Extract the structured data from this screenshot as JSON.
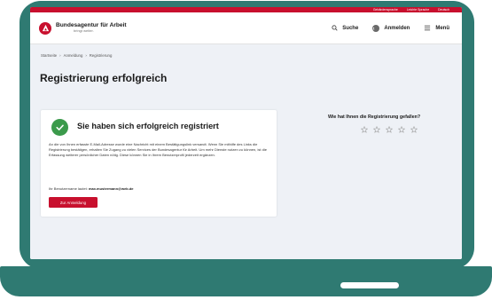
{
  "topbar": {
    "links": [
      "Gebärdensprache",
      "Leichte Sprache",
      "Deutsch"
    ]
  },
  "header": {
    "brand_name": "Bundesagentur für Arbeit",
    "brand_claim": "bringt weiter.",
    "nav": {
      "search_label": "Suche",
      "login_label": "Anmelden",
      "menu_label": "Menü"
    }
  },
  "breadcrumb": [
    "Startseite",
    "Anmeldung",
    "Registrierung"
  ],
  "page": {
    "title": "Registrierung erfolgreich"
  },
  "success_card": {
    "heading": "Sie haben sich erfolgreich registriert",
    "body": "An die von Ihnen erfasste E-Mail-Adresse wurde eine Nachricht mit einem Bestätigungslink versandt. Wenn Sie mithilfe des Links die Registrierung bestätigen, erhalten Sie Zugang zu vielen Services der Bundesagentur für Arbeit. Um mehr Dienste nutzen zu können, ist die Erfassung weiterer persönlicher Daten nötig. Diese können Sie in Ihrem Benutzerprofil jederzeit ergänzen.",
    "username_prefix": "Ihr Benutzername lautet:",
    "username": "max.mustermann@web.de",
    "login_button": "Zur Anmeldung"
  },
  "rating": {
    "title": "Wie hat Ihnen die Registrierung gefallen?",
    "stars_max": 5,
    "stars_value": 0
  },
  "colors": {
    "frame": "#2f7a72",
    "brand_red": "#c8102e",
    "success_green": "#3b9a4b",
    "content_bg": "#eef1f6"
  }
}
